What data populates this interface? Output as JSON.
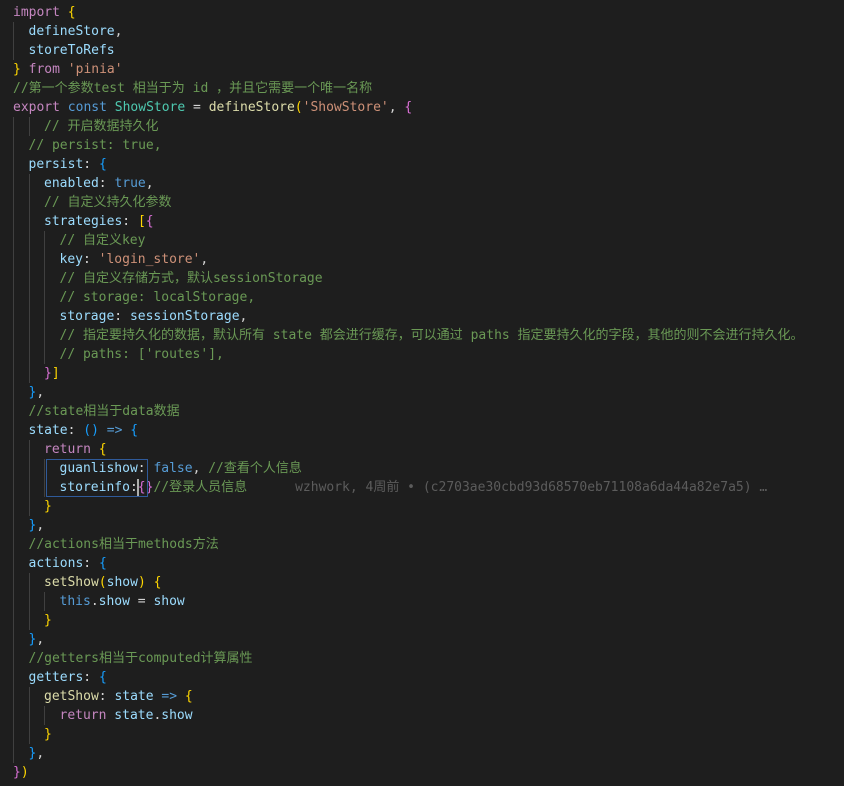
{
  "editor": {
    "language": "javascript",
    "top_partial": "import { ... } from 'pinia'",
    "lines": [
      {
        "indent": 0,
        "tokens": [
          [
            "t-keyword",
            "import"
          ],
          [
            "t-punct",
            " "
          ],
          [
            "t-brace1",
            "{"
          ]
        ]
      },
      {
        "indent": 1,
        "tokens": [
          [
            "t-prop",
            "defineStore"
          ],
          [
            "t-punct",
            ","
          ]
        ]
      },
      {
        "indent": 1,
        "tokens": [
          [
            "t-prop",
            "storeToRefs"
          ]
        ]
      },
      {
        "indent": 0,
        "tokens": [
          [
            "t-brace1",
            "}"
          ],
          [
            "t-punct",
            " "
          ],
          [
            "t-keyword",
            "from"
          ],
          [
            "t-punct",
            " "
          ],
          [
            "t-string",
            "'pinia'"
          ]
        ]
      },
      {
        "indent": 0,
        "tokens": [
          [
            "t-comment",
            "//第一个参数test 相当于为 id ，并且它需要一个唯一名称"
          ]
        ]
      },
      {
        "indent": 0,
        "tokens": [
          [
            "t-keyword",
            "export"
          ],
          [
            "t-punct",
            " "
          ],
          [
            "t-storage",
            "const"
          ],
          [
            "t-punct",
            " "
          ],
          [
            "t-class",
            "ShowStore"
          ],
          [
            "t-punct",
            " = "
          ],
          [
            "t-func",
            "defineStore"
          ],
          [
            "t-brace1",
            "("
          ],
          [
            "t-string",
            "'ShowStore'"
          ],
          [
            "t-punct",
            ", "
          ],
          [
            "t-brace2",
            "{"
          ]
        ]
      },
      {
        "indent": 2,
        "tokens": [
          [
            "t-comment",
            "// 开启数据持久化"
          ]
        ]
      },
      {
        "indent": 1,
        "tokens": [
          [
            "t-comment",
            "// persist: true,"
          ]
        ]
      },
      {
        "indent": 1,
        "tokens": [
          [
            "t-prop",
            "persist"
          ],
          [
            "t-punct",
            ": "
          ],
          [
            "t-brace3",
            "{"
          ]
        ]
      },
      {
        "indent": 2,
        "tokens": [
          [
            "t-prop",
            "enabled"
          ],
          [
            "t-punct",
            ": "
          ],
          [
            "t-bool",
            "true"
          ],
          [
            "t-punct",
            ","
          ]
        ]
      },
      {
        "indent": 2,
        "tokens": [
          [
            "t-comment",
            "// 自定义持久化参数"
          ]
        ]
      },
      {
        "indent": 2,
        "tokens": [
          [
            "t-prop",
            "strategies"
          ],
          [
            "t-punct",
            ": "
          ],
          [
            "t-brace1",
            "["
          ],
          [
            "t-brace2",
            "{"
          ]
        ]
      },
      {
        "indent": 3,
        "tokens": [
          [
            "t-comment",
            "// 自定义key"
          ]
        ]
      },
      {
        "indent": 3,
        "tokens": [
          [
            "t-prop",
            "key"
          ],
          [
            "t-punct",
            ": "
          ],
          [
            "t-string",
            "'login_store'"
          ],
          [
            "t-punct",
            ","
          ]
        ]
      },
      {
        "indent": 3,
        "tokens": [
          [
            "t-comment",
            "// 自定义存储方式，默认sessionStorage"
          ]
        ]
      },
      {
        "indent": 3,
        "tokens": [
          [
            "t-comment",
            "// storage: localStorage,"
          ]
        ]
      },
      {
        "indent": 3,
        "tokens": [
          [
            "t-prop",
            "storage"
          ],
          [
            "t-punct",
            ": "
          ],
          [
            "t-prop",
            "sessionStorage"
          ],
          [
            "t-punct",
            ","
          ]
        ]
      },
      {
        "indent": 3,
        "tokens": [
          [
            "t-comment",
            "// 指定要持久化的数据，默认所有 state 都会进行缓存，可以通过 paths 指定要持久化的字段，其他的则不会进行持久化。"
          ]
        ]
      },
      {
        "indent": 3,
        "tokens": [
          [
            "t-comment",
            "// paths: ['routes'],"
          ]
        ]
      },
      {
        "indent": 2,
        "tokens": [
          [
            "t-brace2",
            "}"
          ],
          [
            "t-brace1",
            "]"
          ]
        ]
      },
      {
        "indent": 1,
        "tokens": [
          [
            "t-brace3",
            "}"
          ],
          [
            "t-punct",
            ","
          ]
        ]
      },
      {
        "indent": 1,
        "tokens": [
          [
            "t-comment",
            "//state相当于data数据"
          ]
        ]
      },
      {
        "indent": 1,
        "tokens": [
          [
            "t-prop",
            "state"
          ],
          [
            "t-punct",
            ": "
          ],
          [
            "t-brace3",
            "()"
          ],
          [
            "t-punct",
            " "
          ],
          [
            "t-storage",
            "=>"
          ],
          [
            "t-punct",
            " "
          ],
          [
            "t-brace3",
            "{"
          ]
        ]
      },
      {
        "indent": 2,
        "tokens": [
          [
            "t-keyword",
            "return"
          ],
          [
            "t-punct",
            " "
          ],
          [
            "t-brace1",
            "{"
          ]
        ]
      },
      {
        "indent": 3,
        "tokens": [
          [
            "t-prop",
            "guanlishow"
          ],
          [
            "t-punct",
            ": "
          ],
          [
            "t-bool",
            "false"
          ],
          [
            "t-punct",
            ", "
          ],
          [
            "t-comment",
            "//查看个人信息"
          ]
        ]
      },
      {
        "indent": 3,
        "tokens": [
          [
            "t-prop",
            "storeinfo"
          ],
          [
            "t-punct",
            ":"
          ],
          [
            "t-brace2",
            "{}"
          ],
          [
            "t-comment",
            "//登录人员信息"
          ]
        ],
        "blame": "wzhwork, 4周前 • (c2703ae30cbd93d68570eb71108a6da44a82e7a5) …"
      },
      {
        "indent": 2,
        "tokens": [
          [
            "t-brace1",
            "}"
          ]
        ]
      },
      {
        "indent": 1,
        "tokens": [
          [
            "t-brace3",
            "}"
          ],
          [
            "t-punct",
            ","
          ]
        ]
      },
      {
        "indent": 1,
        "tokens": [
          [
            "t-comment",
            "//actions相当于methods方法"
          ]
        ]
      },
      {
        "indent": 1,
        "tokens": [
          [
            "t-prop",
            "actions"
          ],
          [
            "t-punct",
            ": "
          ],
          [
            "t-brace3",
            "{"
          ]
        ]
      },
      {
        "indent": 2,
        "tokens": [
          [
            "t-func",
            "setShow"
          ],
          [
            "t-brace1",
            "("
          ],
          [
            "t-prop",
            "show"
          ],
          [
            "t-brace1",
            ")"
          ],
          [
            "t-punct",
            " "
          ],
          [
            "t-brace1",
            "{"
          ]
        ]
      },
      {
        "indent": 3,
        "tokens": [
          [
            "t-this",
            "this"
          ],
          [
            "t-punct",
            "."
          ],
          [
            "t-prop",
            "show"
          ],
          [
            "t-punct",
            " = "
          ],
          [
            "t-prop",
            "show"
          ]
        ]
      },
      {
        "indent": 2,
        "tokens": [
          [
            "t-brace1",
            "}"
          ]
        ]
      },
      {
        "indent": 1,
        "tokens": [
          [
            "t-brace3",
            "}"
          ],
          [
            "t-punct",
            ","
          ]
        ]
      },
      {
        "indent": 1,
        "tokens": [
          [
            "t-comment",
            "//getters相当于computed计算属性"
          ]
        ]
      },
      {
        "indent": 1,
        "tokens": [
          [
            "t-prop",
            "getters"
          ],
          [
            "t-punct",
            ": "
          ],
          [
            "t-brace3",
            "{"
          ]
        ]
      },
      {
        "indent": 2,
        "tokens": [
          [
            "t-func",
            "getShow"
          ],
          [
            "t-punct",
            ": "
          ],
          [
            "t-prop",
            "state"
          ],
          [
            "t-punct",
            " "
          ],
          [
            "t-storage",
            "=>"
          ],
          [
            "t-punct",
            " "
          ],
          [
            "t-brace1",
            "{"
          ]
        ]
      },
      {
        "indent": 3,
        "tokens": [
          [
            "t-keyword",
            "return"
          ],
          [
            "t-punct",
            " "
          ],
          [
            "t-prop",
            "state"
          ],
          [
            "t-punct",
            "."
          ],
          [
            "t-prop",
            "show"
          ]
        ]
      },
      {
        "indent": 2,
        "tokens": [
          [
            "t-brace1",
            "}"
          ]
        ]
      },
      {
        "indent": 1,
        "tokens": [
          [
            "t-brace3",
            "}"
          ],
          [
            "t-punct",
            ","
          ]
        ]
      },
      {
        "indent": 0,
        "tokens": [
          [
            "t-brace2",
            "}"
          ],
          [
            "t-brace1",
            ")"
          ]
        ]
      }
    ]
  }
}
